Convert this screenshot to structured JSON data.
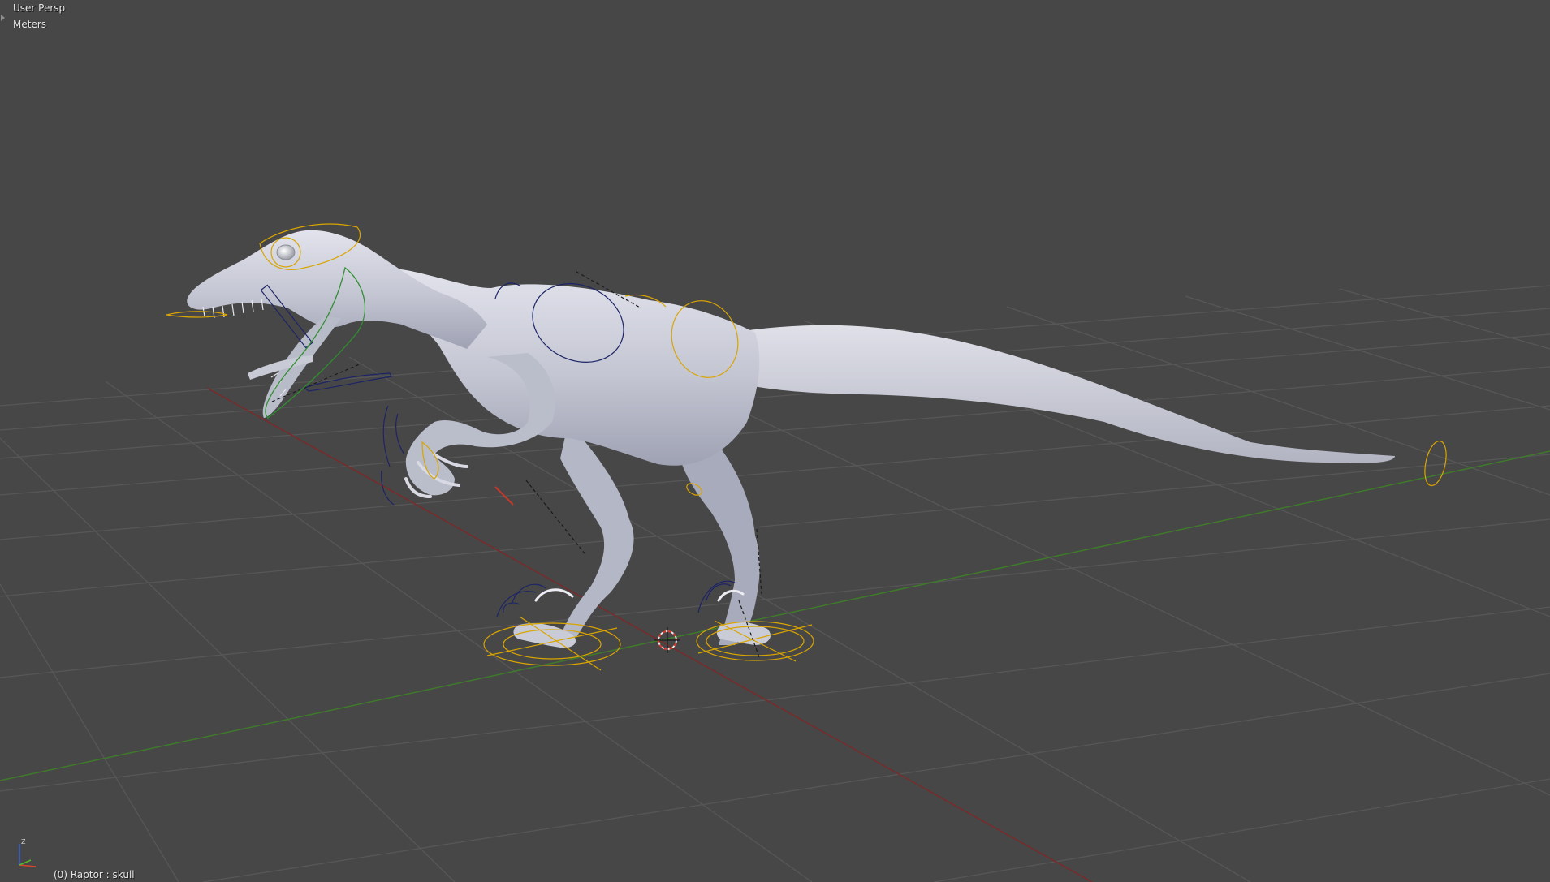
{
  "viewport": {
    "view_name": "User Persp",
    "units": "Meters",
    "active_object": "(0) Raptor : skull",
    "background_color": "#474747",
    "grid_color": "#545454",
    "x_axis_color": "#7a2a2a",
    "y_axis_color": "#3f7a2a",
    "rig_selected_color": "#d9a500",
    "rig_bone_color": "#1d2466",
    "rig_active_color": "#2f8f2f",
    "mesh_color": "#c8cad6"
  },
  "axis_gizmo": {
    "z_label": "Z",
    "icons": [
      "x-axis-icon",
      "y-axis-icon",
      "z-axis-icon"
    ]
  },
  "icons": {
    "corner_widget": "corner-arrow-icon",
    "cursor": "3d-cursor-icon"
  }
}
